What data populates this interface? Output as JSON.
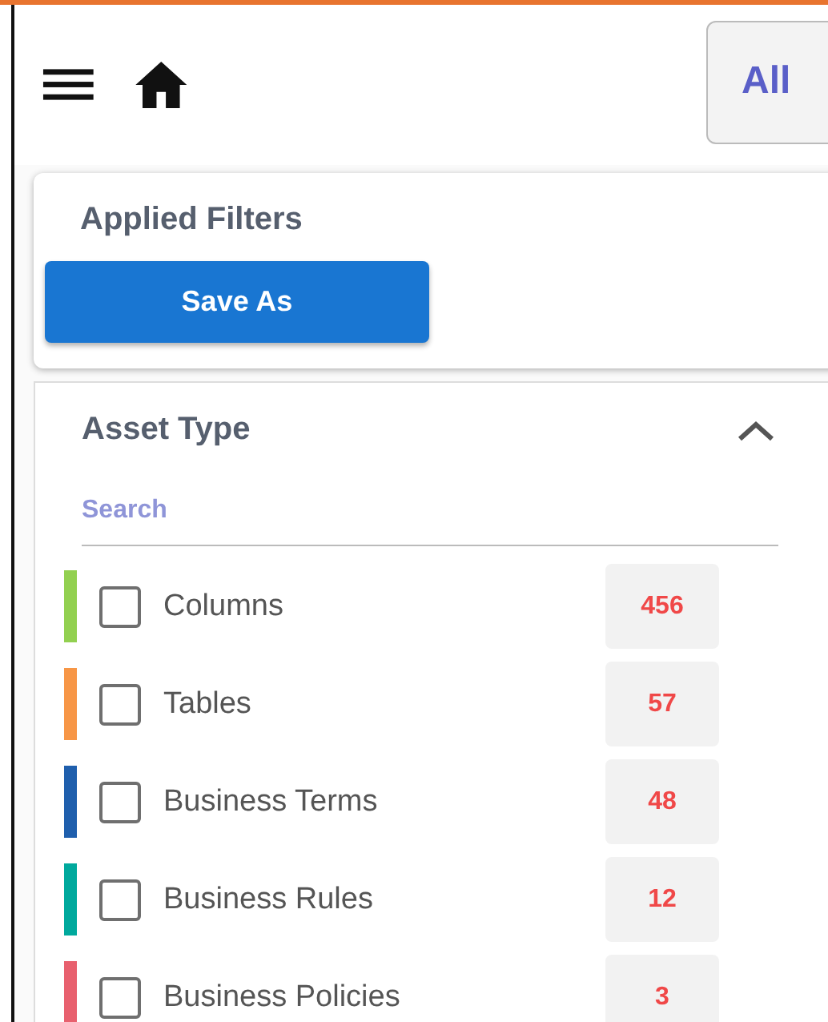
{
  "header": {
    "scope_dropdown": {
      "value": "All"
    }
  },
  "applied_filters": {
    "title": "Applied Filters",
    "save_button": "Save As"
  },
  "asset_type": {
    "title": "Asset Type",
    "expanded": true,
    "search": {
      "placeholder": "Search"
    },
    "items": [
      {
        "label": "Columns",
        "count": "456",
        "color": "#92d050",
        "checked": false
      },
      {
        "label": "Tables",
        "count": "57",
        "color": "#f79646",
        "checked": false
      },
      {
        "label": "Business Terms",
        "count": "48",
        "color": "#1f5fad",
        "checked": false
      },
      {
        "label": "Business Rules",
        "count": "12",
        "color": "#00a99d",
        "checked": false
      },
      {
        "label": "Business Policies",
        "count": "3",
        "color": "#e8606e",
        "checked": false
      }
    ]
  }
}
